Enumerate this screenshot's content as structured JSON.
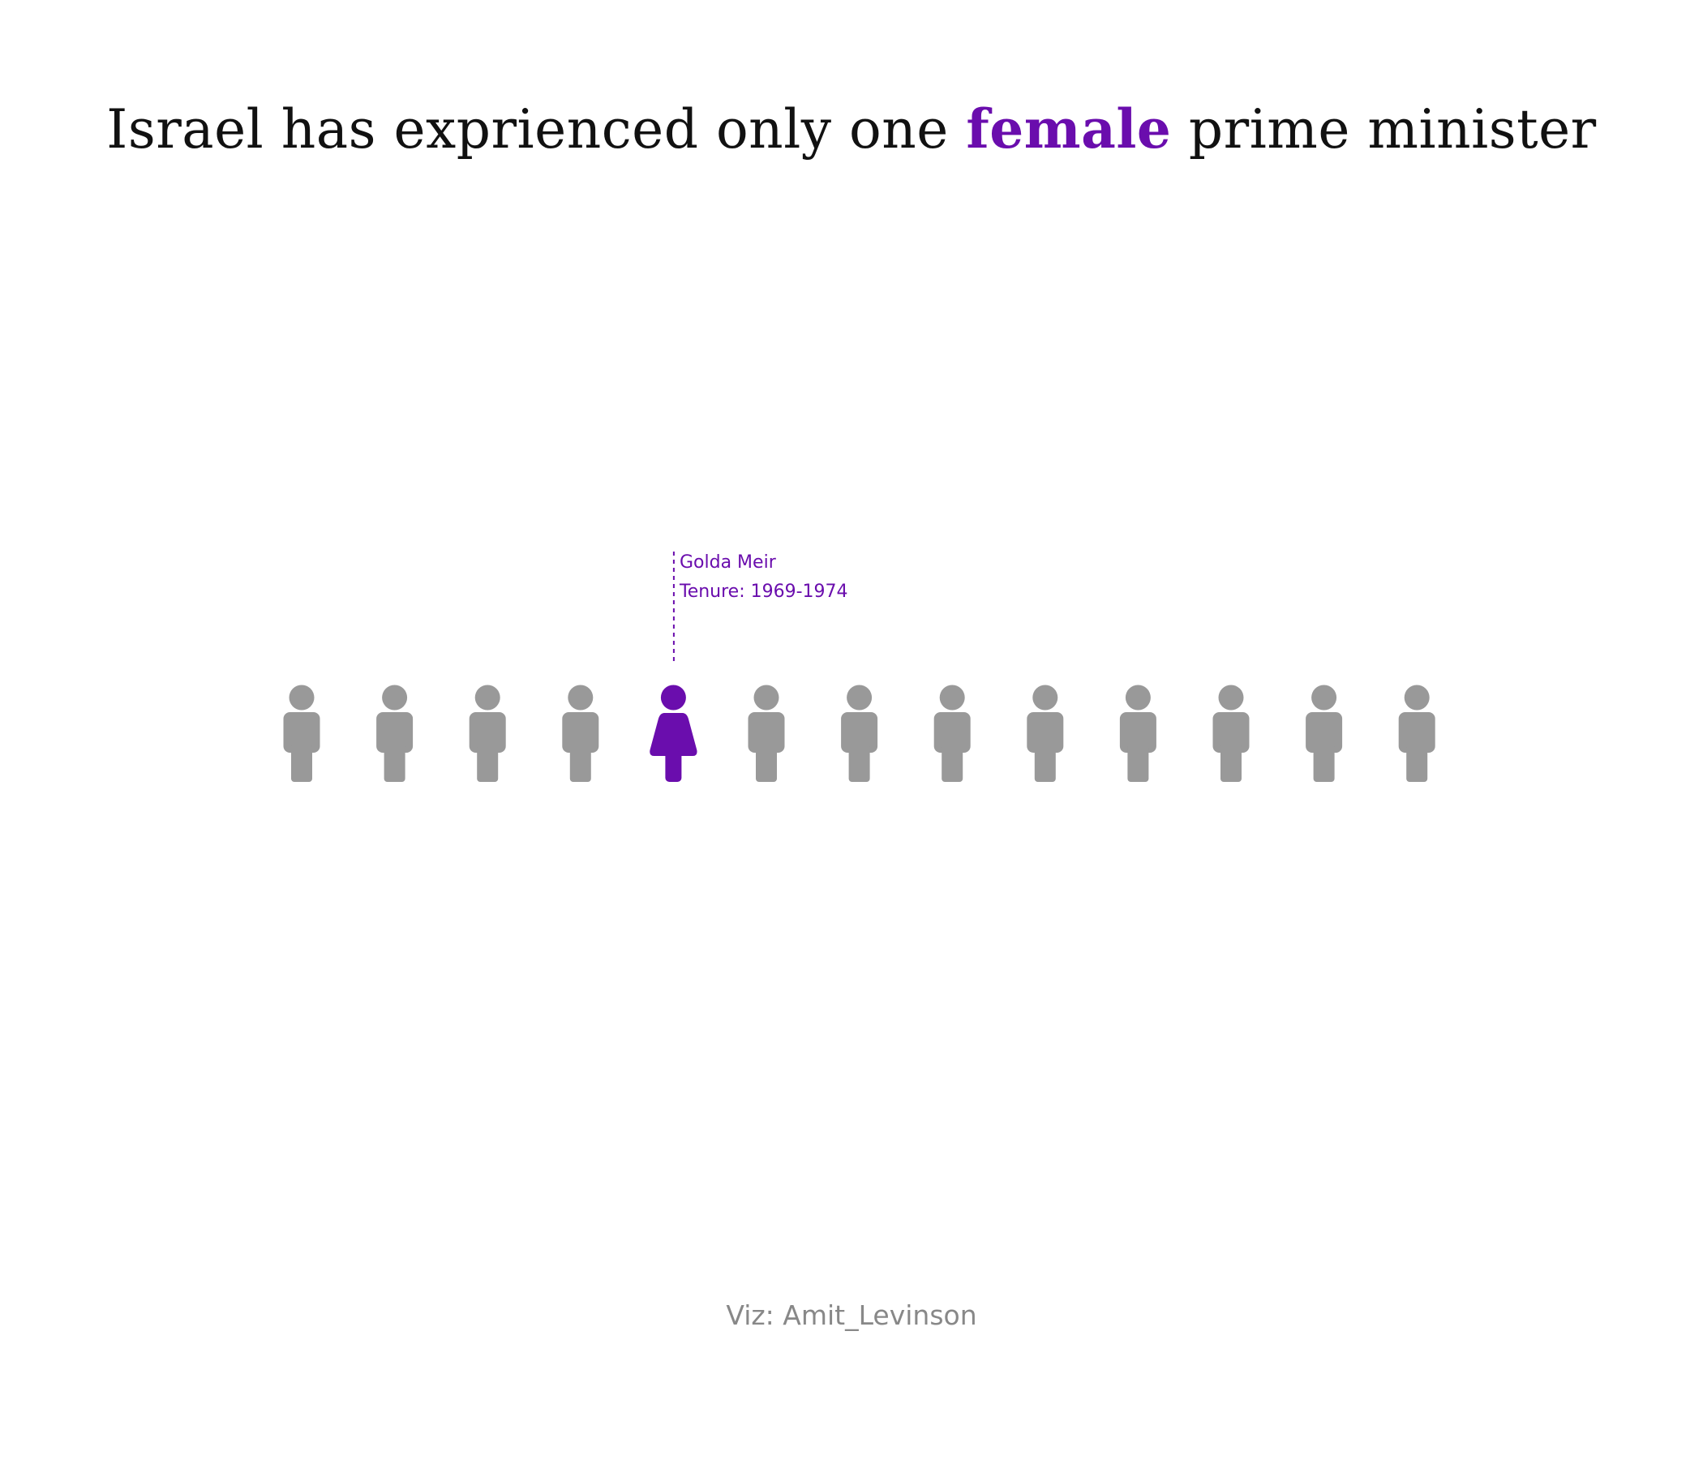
{
  "chart_data": {
    "type": "pictogram",
    "title_parts": {
      "before": "Israel has exprienced only one",
      "highlight": "female",
      "after": "prime minister"
    },
    "total": 13,
    "highlight_index": 4,
    "annotation": {
      "name": "Golda Meir",
      "tenure": "Tenure: 1969-1974"
    },
    "caption": "Viz: Amit_Levinson"
  },
  "colors": {
    "male": "#999999",
    "female": "#6a0dad",
    "title": "#111111",
    "caption": "#888888"
  },
  "icons": {
    "male": "person-icon",
    "female": "woman-icon"
  }
}
